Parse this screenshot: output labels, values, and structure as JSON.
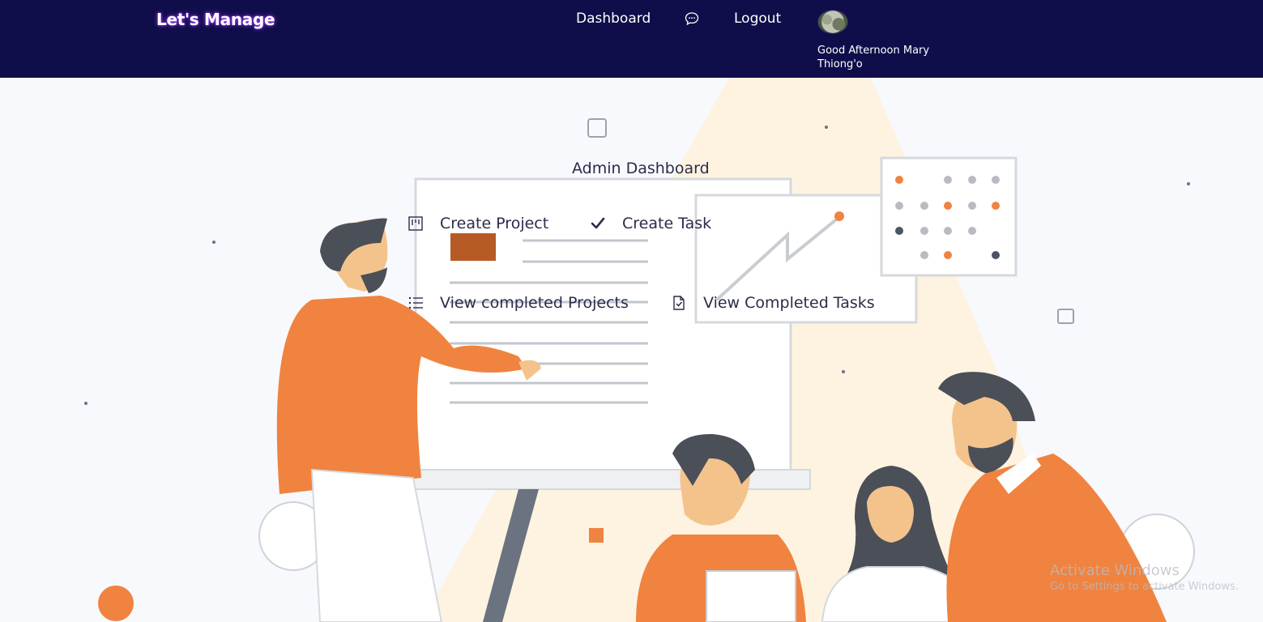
{
  "navbar": {
    "brand": "Let's Manage",
    "dashboard_label": "Dashboard",
    "logout_label": "Logout",
    "greeting": "Good Afternoon Mary Thiong'o",
    "chat_icon": "chat-bubble-icon"
  },
  "main": {
    "title": "Admin Dashboard",
    "actions": [
      {
        "label": "Create Project",
        "icon": "kanban-board-icon"
      },
      {
        "label": "Create Task",
        "icon": "checkmark-icon"
      },
      {
        "label": "View completed Projects",
        "icon": "list-icon"
      },
      {
        "label": "View Completed Tasks",
        "icon": "file-check-icon"
      }
    ]
  },
  "watermark": {
    "title": "Activate Windows",
    "subtitle": "Go to Settings to activate Windows."
  },
  "colors": {
    "navbar_bg": "#0f0e4a",
    "accent_orange": "#f0833f",
    "text_dark": "#2c2c4a"
  }
}
